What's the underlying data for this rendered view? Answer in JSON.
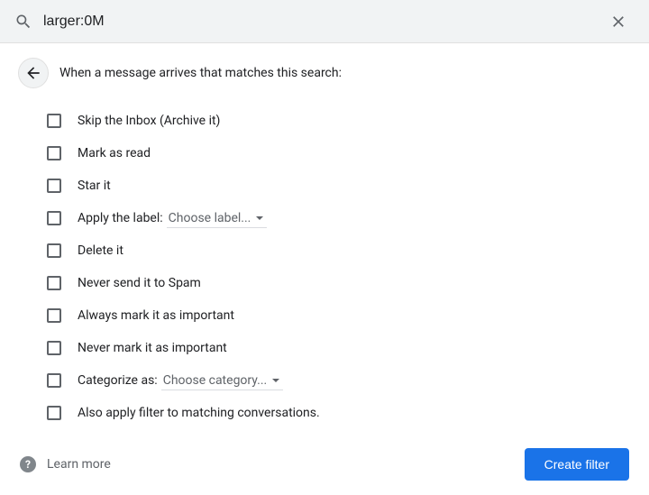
{
  "search": {
    "value": "larger:0M"
  },
  "header": {
    "title": "When a message arrives that matches this search:"
  },
  "options": {
    "skip_inbox": "Skip the Inbox (Archive it)",
    "mark_read": "Mark as read",
    "star_it": "Star it",
    "apply_label": "Apply the label:",
    "apply_label_value": "Choose label...",
    "delete_it": "Delete it",
    "never_spam": "Never send it to Spam",
    "always_important": "Always mark it as important",
    "never_important": "Never mark it as important",
    "categorize_as": "Categorize as:",
    "categorize_value": "Choose category...",
    "also_apply": "Also apply filter to matching conversations."
  },
  "footer": {
    "learn_more": "Learn more",
    "create_filter": "Create filter",
    "help_glyph": "?"
  }
}
